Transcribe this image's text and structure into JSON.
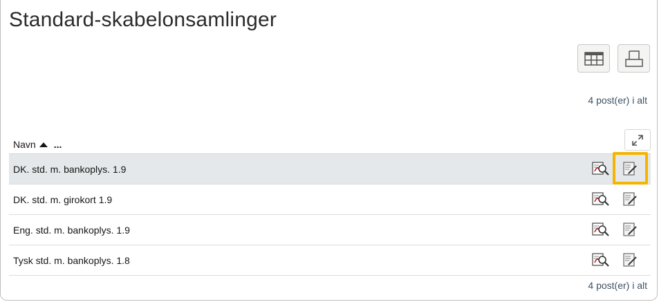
{
  "page": {
    "title": "Standard-skabelonsamlinger"
  },
  "toolbar": {
    "view_icon": "table-view-icon",
    "print_icon": "print-icon"
  },
  "records": {
    "count_label": "4 post(er) i alt"
  },
  "table": {
    "columns": [
      {
        "label": "Navn",
        "sort": "ascending"
      }
    ],
    "more_label": "...",
    "expand_icon": "expand-icon",
    "rows": [
      {
        "name": "DK. std. m. bankoplys. 1.9",
        "selected": true
      },
      {
        "name": "DK. std. m. girokort 1.9",
        "selected": false
      },
      {
        "name": "Eng. std. m. bankoplys. 1.9",
        "selected": false
      },
      {
        "name": "Tysk std. m. bankoplys. 1.8",
        "selected": false
      }
    ],
    "row_actions": [
      "preview-pdf-icon",
      "edit-document-icon"
    ]
  },
  "colors": {
    "highlight": "#f5b400",
    "selected_row": "#e4e8ea",
    "link_text": "#3d5164"
  }
}
